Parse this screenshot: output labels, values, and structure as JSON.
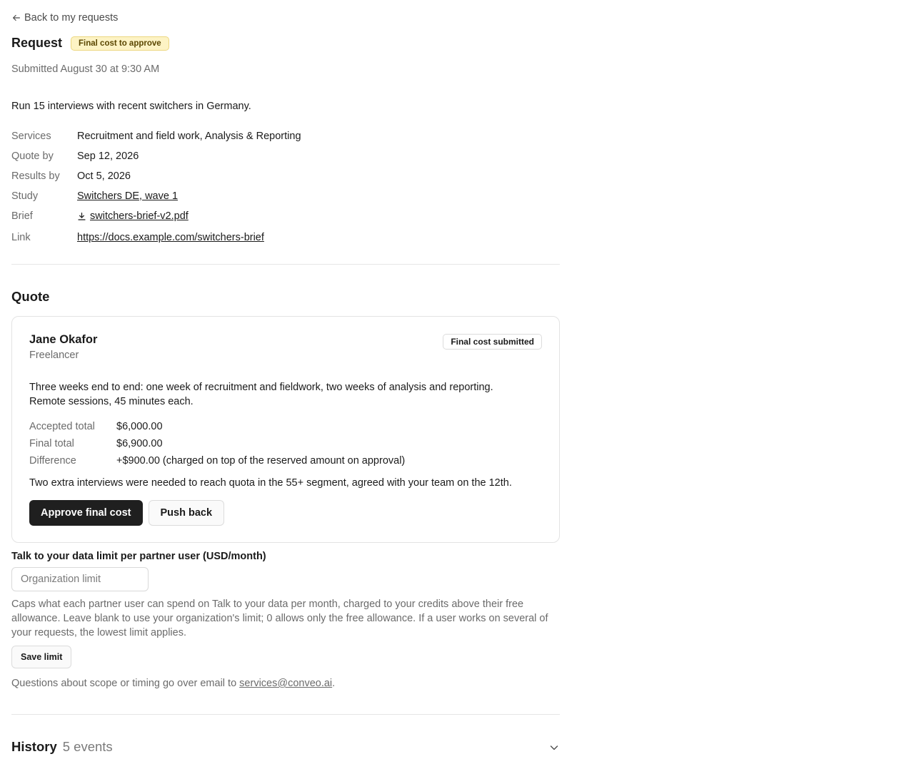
{
  "nav": {
    "back_label": "Back to my requests"
  },
  "request": {
    "title": "Request",
    "status_badge": "Final cost to approve",
    "submitted": "Submitted August 30 at 9:30 AM",
    "description": "Run 15 interviews with recent switchers in Germany.",
    "fields": {
      "services": {
        "label": "Services",
        "value": "Recruitment and field work, Analysis & Reporting"
      },
      "quote_by": {
        "label": "Quote by",
        "value": "Sep 12, 2026"
      },
      "results_by": {
        "label": "Results by",
        "value": "Oct 5, 2026"
      },
      "study": {
        "label": "Study",
        "value": "Switchers DE, wave 1"
      },
      "brief": {
        "label": "Brief",
        "value": "switchers-brief-v2.pdf"
      },
      "link": {
        "label": "Link",
        "value": "https://docs.example.com/switchers-brief"
      }
    }
  },
  "quote": {
    "heading": "Quote",
    "partner_name": "Jane Okafor",
    "partner_role": "Freelancer",
    "status_badge": "Final cost submitted",
    "description": "Three weeks end to end: one week of recruitment and fieldwork, two weeks of analysis and reporting. Remote sessions, 45 minutes each.",
    "totals": {
      "accepted": {
        "label": "Accepted total",
        "value": "$6,000.00"
      },
      "final": {
        "label": "Final total",
        "value": "$6,900.00"
      },
      "difference": {
        "label": "Difference",
        "value": "+$900.00 (charged on top of the reserved amount on approval)"
      }
    },
    "note": "Two extra interviews were needed to reach quota in the 55+ segment, agreed with your team on the 12th.",
    "approve_label": "Approve final cost",
    "pushback_label": "Push back"
  },
  "limit": {
    "label": "Talk to your data limit per partner user (USD/month)",
    "value": "",
    "placeholder": "Organization limit",
    "help": "Caps what each partner user can spend on Talk to your data per month, charged to your credits above their free allowance. Leave blank to use your organization's limit; 0 allows only the free allowance. If a user works on several of your requests, the lowest limit applies.",
    "save_label": "Save limit"
  },
  "contact": {
    "prefix": "Questions about scope or timing go over email to ",
    "email": "services@conveo.ai",
    "suffix": "."
  },
  "history": {
    "heading": "History",
    "count": "5 events"
  },
  "colors": {
    "badge_yellow_bg": "#fdf3c4",
    "primary_button": "#1f1f1f"
  }
}
